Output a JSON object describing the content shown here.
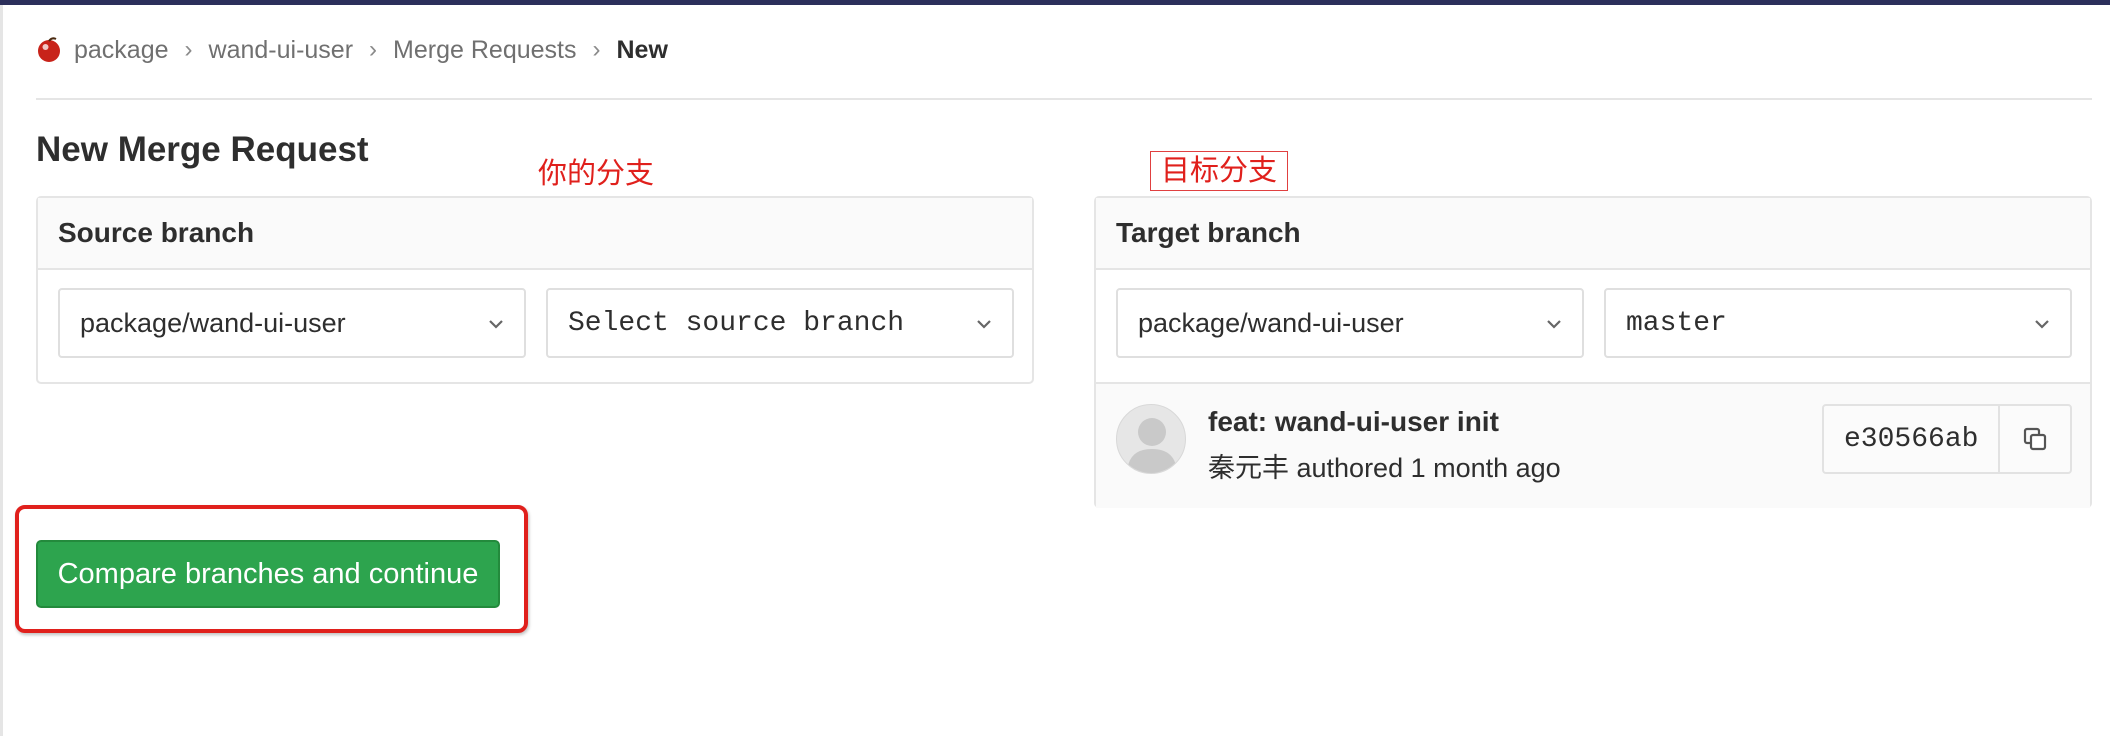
{
  "breadcrumb": {
    "items": [
      "package",
      "wand-ui-user",
      "Merge Requests"
    ],
    "current": "New",
    "separator": "›"
  },
  "page": {
    "title": "New Merge Request"
  },
  "annotations": {
    "source": "你的分支",
    "target": "目标分支"
  },
  "source_branch": {
    "header": "Source branch",
    "project": "package/wand-ui-user",
    "branch_placeholder": "Select source branch"
  },
  "target_branch": {
    "header": "Target branch",
    "project": "package/wand-ui-user",
    "branch": "master",
    "commit": {
      "title": "feat: wand-ui-user init",
      "meta": "秦元丰 authored 1 month ago",
      "sha": "e30566ab"
    }
  },
  "actions": {
    "compare_label": "Compare branches and continue"
  },
  "colors": {
    "accent_green": "#2da44e",
    "annotation_red": "#e0201c",
    "topbar": "#2c2f5b"
  },
  "icons": [
    "project-logo-icon",
    "chevron-down-icon",
    "copy-icon",
    "avatar-placeholder-icon"
  ]
}
